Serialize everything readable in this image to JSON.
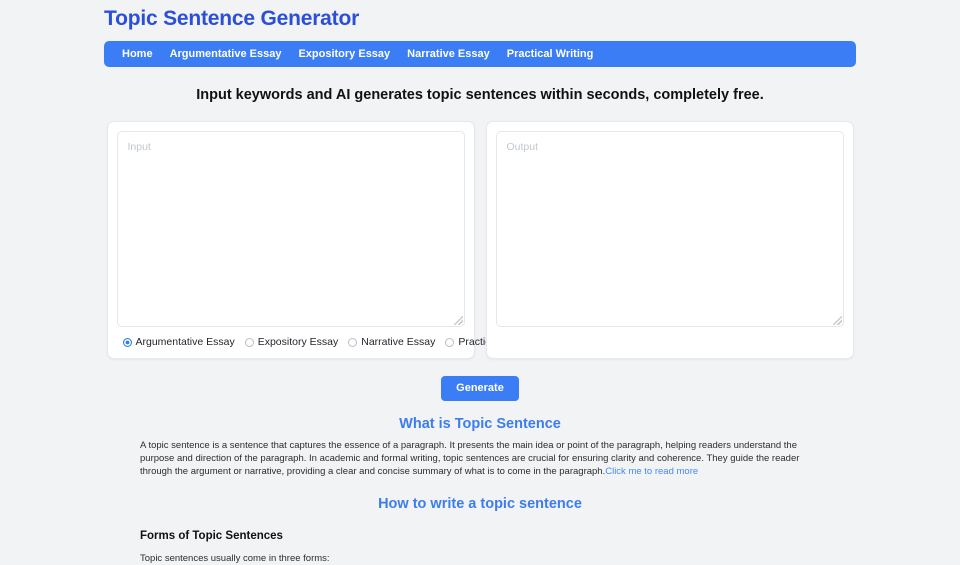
{
  "header": {
    "title": "Topic Sentence Generator",
    "nav": [
      {
        "label": "Home"
      },
      {
        "label": "Argumentative Essay"
      },
      {
        "label": "Expository Essay"
      },
      {
        "label": "Narrative Essay"
      },
      {
        "label": "Practical Writing"
      }
    ]
  },
  "tagline": "Input keywords and AI generates topic sentences within seconds, completely free.",
  "editor": {
    "input_placeholder": "Input",
    "input_value": "",
    "output_placeholder": "Output",
    "output_value": "",
    "options": [
      {
        "label": "Argumentative Essay",
        "selected": true
      },
      {
        "label": "Expository Essay",
        "selected": false
      },
      {
        "label": "Narrative Essay",
        "selected": false
      },
      {
        "label": "Practical Writing",
        "selected": false
      }
    ],
    "generate_label": "Generate"
  },
  "sections": {
    "what_is": {
      "heading": "What is Topic Sentence",
      "paragraph": "A topic sentence is a sentence that captures the essence of a paragraph. It presents the main idea or point of the paragraph, helping readers understand the purpose and direction of the paragraph. In academic and formal writing, topic sentences are crucial for ensuring clarity and coherence. They guide the reader through the argument or narrative, providing a clear and concise summary of what is to come in the paragraph.",
      "link_text": "Click me to read more"
    },
    "how_to": {
      "heading": "How to write a topic sentence",
      "sub_heading": "Forms of Topic Sentences",
      "sub_paragraph": "Topic sentences usually come in three forms:"
    }
  },
  "colors": {
    "page_background": "#f2f3f5",
    "title_blue": "#2b4fd8",
    "nav_blue": "#3b7df4",
    "heading_blue": "#3b7df0",
    "link_blue": "#4a8ae8",
    "button_blue": "#3b7df4",
    "card_white": "#ffffff",
    "card_border": "#e6e8eb",
    "placeholder_gray": "#c2c7cd"
  }
}
